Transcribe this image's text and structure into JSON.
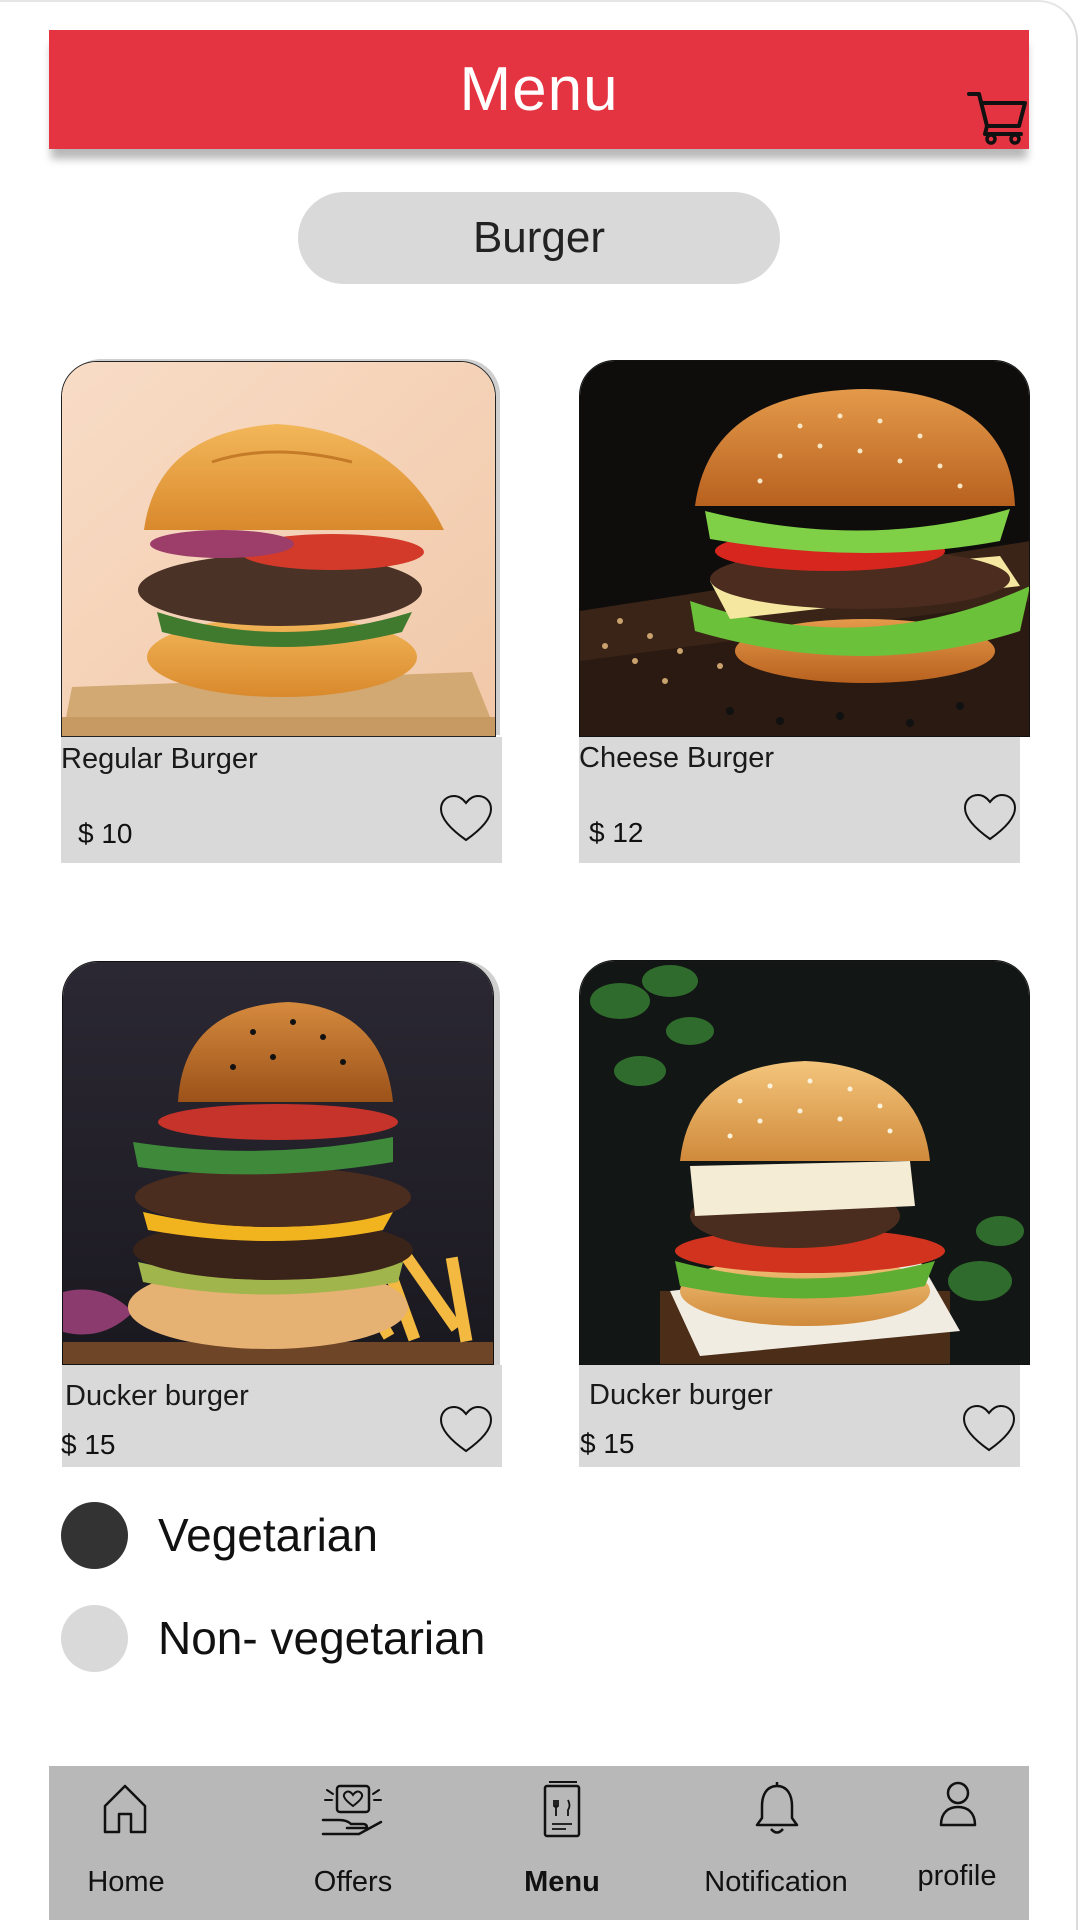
{
  "header": {
    "title": "Menu"
  },
  "category": {
    "label": "Burger"
  },
  "products": [
    {
      "name": "Regular Burger",
      "price": "$ 10"
    },
    {
      "name": "Cheese Burger",
      "price": "$ 12"
    },
    {
      "name": "Ducker burger",
      "price": "$ 15"
    },
    {
      "name": "Ducker burger",
      "price": "$ 15"
    }
  ],
  "filters": [
    {
      "label": "Vegetarian",
      "selected": true
    },
    {
      "label": "Non- vegetarian",
      "selected": false
    }
  ],
  "nav": [
    {
      "label": "Home",
      "icon": "home-icon",
      "active": false
    },
    {
      "label": "Offers",
      "icon": "offers-icon",
      "active": false
    },
    {
      "label": "Menu",
      "icon": "menu-book-icon",
      "active": true
    },
    {
      "label": "Notification",
      "icon": "bell-icon",
      "active": false
    },
    {
      "label": "profile",
      "icon": "user-icon",
      "active": false
    }
  ],
  "colors": {
    "accent": "#e53441",
    "pill": "#d9d9d9",
    "nav_bg": "#b8b8b8",
    "selected_radio": "#333333",
    "unselected_radio": "#d9d9d9"
  }
}
